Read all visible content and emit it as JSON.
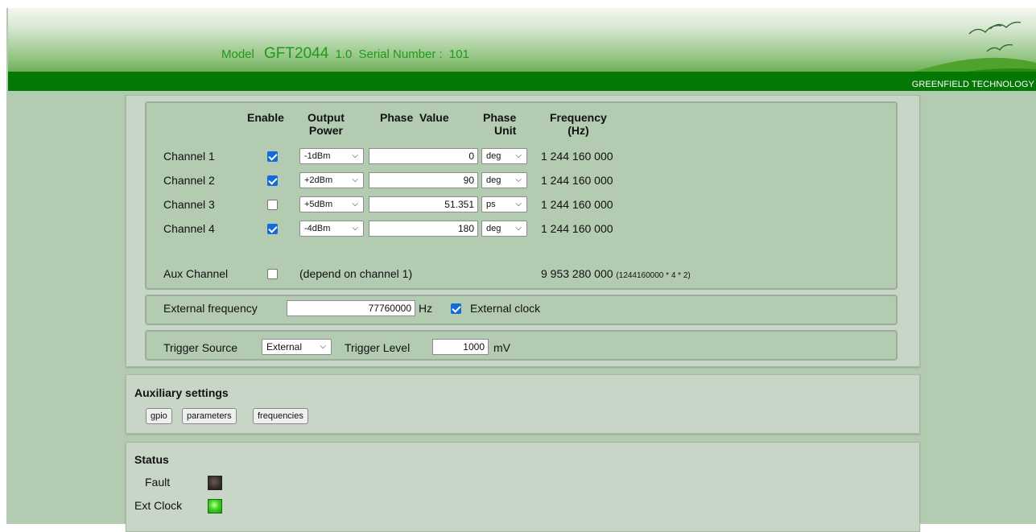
{
  "header": {
    "model_label": "Model",
    "model_name": "GFT2044",
    "version": "1.0",
    "serial_label": "Serial Number :",
    "serial_value": "101",
    "brand": "GREENFIELD TECHNOLOGY"
  },
  "channels_table": {
    "headers": {
      "enable": "Enable",
      "output_power_1": "Output",
      "output_power_2": "Power",
      "phase_value": "Phase  Value",
      "phase_unit_1": "Phase",
      "phase_unit_2": "Unit",
      "frequency_1": "Frequency",
      "frequency_2": "(Hz)"
    },
    "rows": [
      {
        "label": "Channel 1",
        "enabled": true,
        "power": "-1dBm",
        "phase": "0",
        "unit": "deg",
        "frequency": "1 244 160 000"
      },
      {
        "label": "Channel 2",
        "enabled": true,
        "power": "+2dBm",
        "phase": "90",
        "unit": "deg",
        "frequency": "1 244 160 000"
      },
      {
        "label": "Channel 3",
        "enabled": false,
        "power": "+5dBm",
        "phase": "51.351",
        "unit": "ps",
        "frequency": "1 244 160 000"
      },
      {
        "label": "Channel 4",
        "enabled": true,
        "power": "-4dBm",
        "phase": "180",
        "unit": "deg",
        "frequency": "1 244 160 000"
      }
    ],
    "aux": {
      "label": "Aux Channel",
      "enabled": false,
      "note": "(depend on channel 1)",
      "frequency": "9 953 280 000",
      "formula": "(1244160000 * 4 * 2)"
    }
  },
  "external": {
    "label": "External frequency",
    "value": "77760000",
    "unit": "Hz",
    "clock_label": "External clock",
    "clock_enabled": true
  },
  "trigger": {
    "source_label": "Trigger Source",
    "source_value": "External",
    "level_label": "Trigger Level",
    "level_value": "1000",
    "level_unit": "mV"
  },
  "auxiliary": {
    "title": "Auxiliary settings",
    "buttons": [
      "gpio",
      "parameters",
      "frequencies"
    ]
  },
  "status": {
    "title": "Status",
    "fault_label": "Fault",
    "ext_clock_label": "Ext Clock",
    "fault_color": "#2f2624",
    "ext_clock_color": "#3fd422"
  },
  "colors": {
    "page_bg": "#b3cbb1",
    "header_bar": "#047804",
    "header_text": "#1f9a1c",
    "checkbox_on": "#1669d8"
  }
}
